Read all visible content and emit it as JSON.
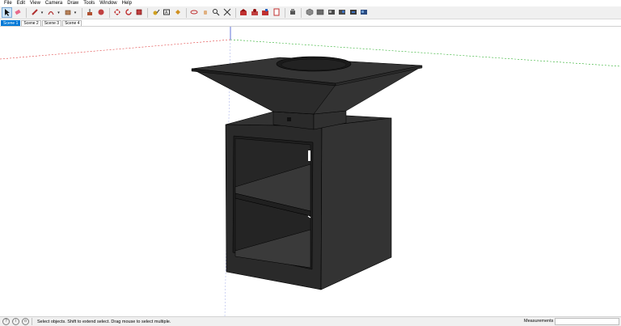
{
  "menu": [
    "File",
    "Edit",
    "View",
    "Camera",
    "Draw",
    "Tools",
    "Window",
    "Help"
  ],
  "toolbar": {
    "tools": [
      {
        "name": "select-tool",
        "icon": "arrow-cursor-icon",
        "active": true
      },
      {
        "name": "eraser-tool",
        "icon": "eraser-icon"
      },
      {
        "name": "line-tool",
        "icon": "pencil-icon",
        "dropdown": true
      },
      {
        "name": "arc-tool",
        "icon": "arc-icon",
        "dropdown": true
      },
      {
        "name": "rectangle-tool",
        "icon": "rectangle-icon",
        "dropdown": true
      },
      {
        "name": "push-pull-tool",
        "icon": "push-pull-icon"
      },
      {
        "name": "follow-me-tool",
        "icon": "follow-me-icon"
      },
      {
        "name": "move-tool",
        "icon": "move-arrows-icon"
      },
      {
        "name": "rotate-tool",
        "icon": "rotate-icon"
      },
      {
        "name": "scale-tool",
        "icon": "scale-icon"
      },
      {
        "name": "tape-measure-tool",
        "icon": "tape-measure-icon"
      },
      {
        "name": "text-tool",
        "icon": "text-icon"
      },
      {
        "name": "paint-bucket-tool",
        "icon": "paint-bucket-icon"
      },
      {
        "name": "orbit-tool",
        "icon": "orbit-icon"
      },
      {
        "name": "pan-tool",
        "icon": "hand-icon"
      },
      {
        "name": "zoom-tool",
        "icon": "magnifier-icon"
      },
      {
        "name": "zoom-extents-tool",
        "icon": "zoom-extents-icon"
      },
      {
        "name": "warehouse-tool",
        "icon": "warehouse-icon"
      },
      {
        "name": "share-model-tool",
        "icon": "share-model-icon"
      },
      {
        "name": "extension-warehouse-tool",
        "icon": "extension-warehouse-icon"
      },
      {
        "name": "layout-tool",
        "icon": "layout-icon"
      },
      {
        "name": "components-tool",
        "icon": "components-icon"
      },
      {
        "name": "iso-view-tool",
        "icon": "iso-view-icon"
      },
      {
        "name": "top-view-tool",
        "icon": "top-view-icon"
      },
      {
        "name": "front-view-tool",
        "icon": "front-view-icon"
      },
      {
        "name": "right-view-tool",
        "icon": "right-view-icon"
      },
      {
        "name": "back-view-tool",
        "icon": "back-view-icon"
      },
      {
        "name": "left-view-tool",
        "icon": "left-view-icon"
      }
    ]
  },
  "scenes": [
    {
      "label": "Scene 1",
      "active": true
    },
    {
      "label": "Scene 2"
    },
    {
      "label": "Scene 3"
    },
    {
      "label": "Scene 4"
    }
  ],
  "colors": {
    "model": "#2a2a2a",
    "model_dark": "#1c1c1c",
    "model_light": "#3a3a3a",
    "axis_red": "#e04040",
    "axis_green": "#2fb02f",
    "axis_blue": "#3a50d0",
    "active_tab": "#0078d7"
  },
  "status": {
    "message": "Select objects. Shift to extend select. Drag mouse to select multiple.",
    "measurements_label": "Measurements",
    "measurements_value": ""
  }
}
